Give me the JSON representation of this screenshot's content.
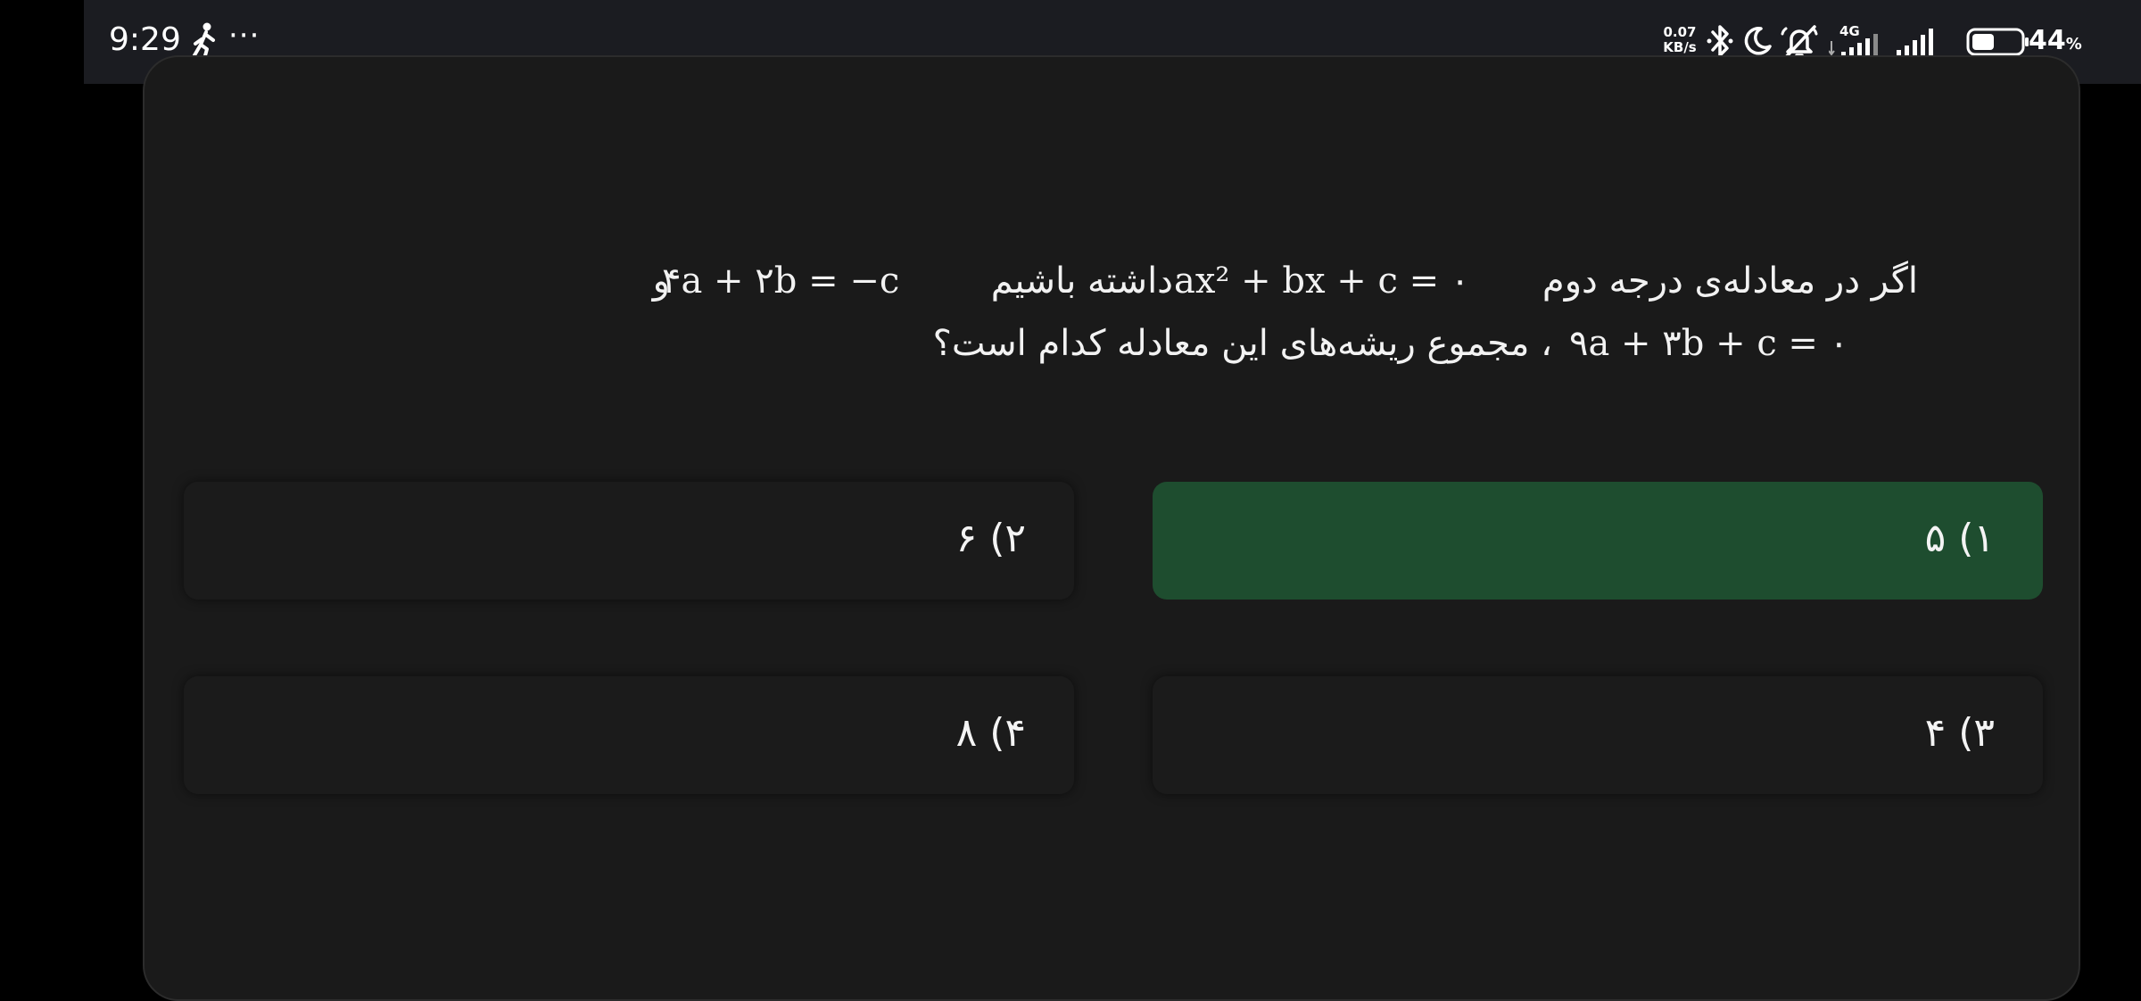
{
  "status_bar": {
    "time": "9:29",
    "more": "···",
    "net_speed_value": "0.07",
    "net_speed_unit": "KB/s",
    "network_type": "4G",
    "battery_level": "44",
    "battery_unit": "%",
    "battery_fraction": 0.44,
    "icons": [
      "walk-icon",
      "bluetooth-icon",
      "moon-icon",
      "bell-off-icon",
      "signal-4g-icon",
      "signal-icon",
      "battery-icon"
    ]
  },
  "question": {
    "line1_text_a": "اگر در معادله‌ی درجه دوم",
    "line1_math_a": "ax² + bx + c = ۰",
    "line1_text_b": "داشته باشیم",
    "line1_math_b": "۴a + ۲b = −c",
    "line1_text_c": "و",
    "line2_math": "۹a + ۳b + c = ۰",
    "line2_text": "، مجموع ریشه‌های این معادله کدام است؟"
  },
  "options": [
    {
      "label": "۱) ۵",
      "selected": true
    },
    {
      "label": "۲) ۶",
      "selected": false
    },
    {
      "label": "۳) ۴",
      "selected": false
    },
    {
      "label": "۴) ۸",
      "selected": false
    }
  ],
  "colors": {
    "selected_option": "#1e4d2f",
    "card_background": "#1a1a1a",
    "status_bar": "#1b1c21"
  }
}
